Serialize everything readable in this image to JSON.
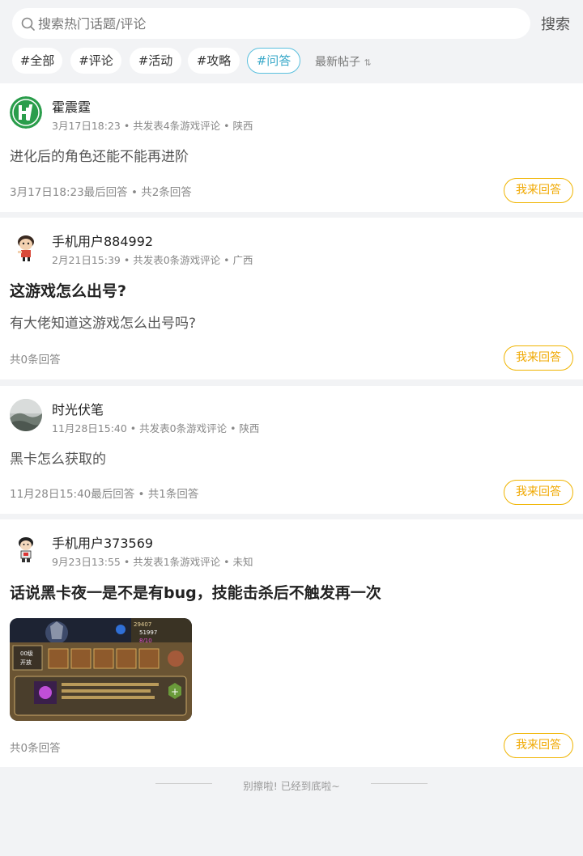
{
  "search": {
    "placeholder": "搜索热门话题/评论",
    "button_label": "搜索",
    "icon": "search-icon"
  },
  "tags": [
    {
      "label": "#全部",
      "active": false
    },
    {
      "label": "#评论",
      "active": false
    },
    {
      "label": "#活动",
      "active": false
    },
    {
      "label": "#攻略",
      "active": false
    },
    {
      "label": "#问答",
      "active": true
    }
  ],
  "sort": {
    "label": "最新帖子",
    "icon": "sort-icon"
  },
  "posts": [
    {
      "user": "霍震霆",
      "meta": "3月17日18:23 • 共发表4条游戏评论 • 陕西",
      "title": "",
      "body": "进化后的角色还能不能再进阶",
      "footer": "3月17日18:23最后回答 • 共2条回答",
      "answer_label": "我来回答",
      "avatar": "logo-avatar"
    },
    {
      "user": "手机用户884992",
      "meta": "2月21日15:39 • 共发表0条游戏评论 • 广西",
      "title": "这游戏怎么出号?",
      "body": "有大佬知道这游戏怎么出号吗?",
      "footer": "共0条回答",
      "answer_label": "我来回答",
      "avatar": "cartoon-avatar"
    },
    {
      "user": "时光伏笔",
      "meta": "11月28日15:40 • 共发表0条游戏评论 • 陕西",
      "title": "",
      "body": "黑卡怎么获取的",
      "footer": "11月28日15:40最后回答 • 共1条回答",
      "answer_label": "我来回答",
      "avatar": "landscape-avatar"
    },
    {
      "user": "手机用户373569",
      "meta": "9月23日13:55 • 共发表1条游戏评论 • 未知",
      "title": "话说黑卡夜一是不是有bug，技能击杀后不触发再一次",
      "body": "",
      "footer": "共0条回答",
      "answer_label": "我来回答",
      "avatar": "cartoon-avatar",
      "image": {
        "stats": [
          "29407",
          "51997",
          "8/10"
        ],
        "level_label": "00级",
        "start_label": "开放"
      }
    }
  ],
  "end_message": "别擦啦! 已经到底啦~",
  "colors": {
    "accent": "#f0b400",
    "active_tag": "#5bc0de",
    "background": "#f2f3f5"
  }
}
